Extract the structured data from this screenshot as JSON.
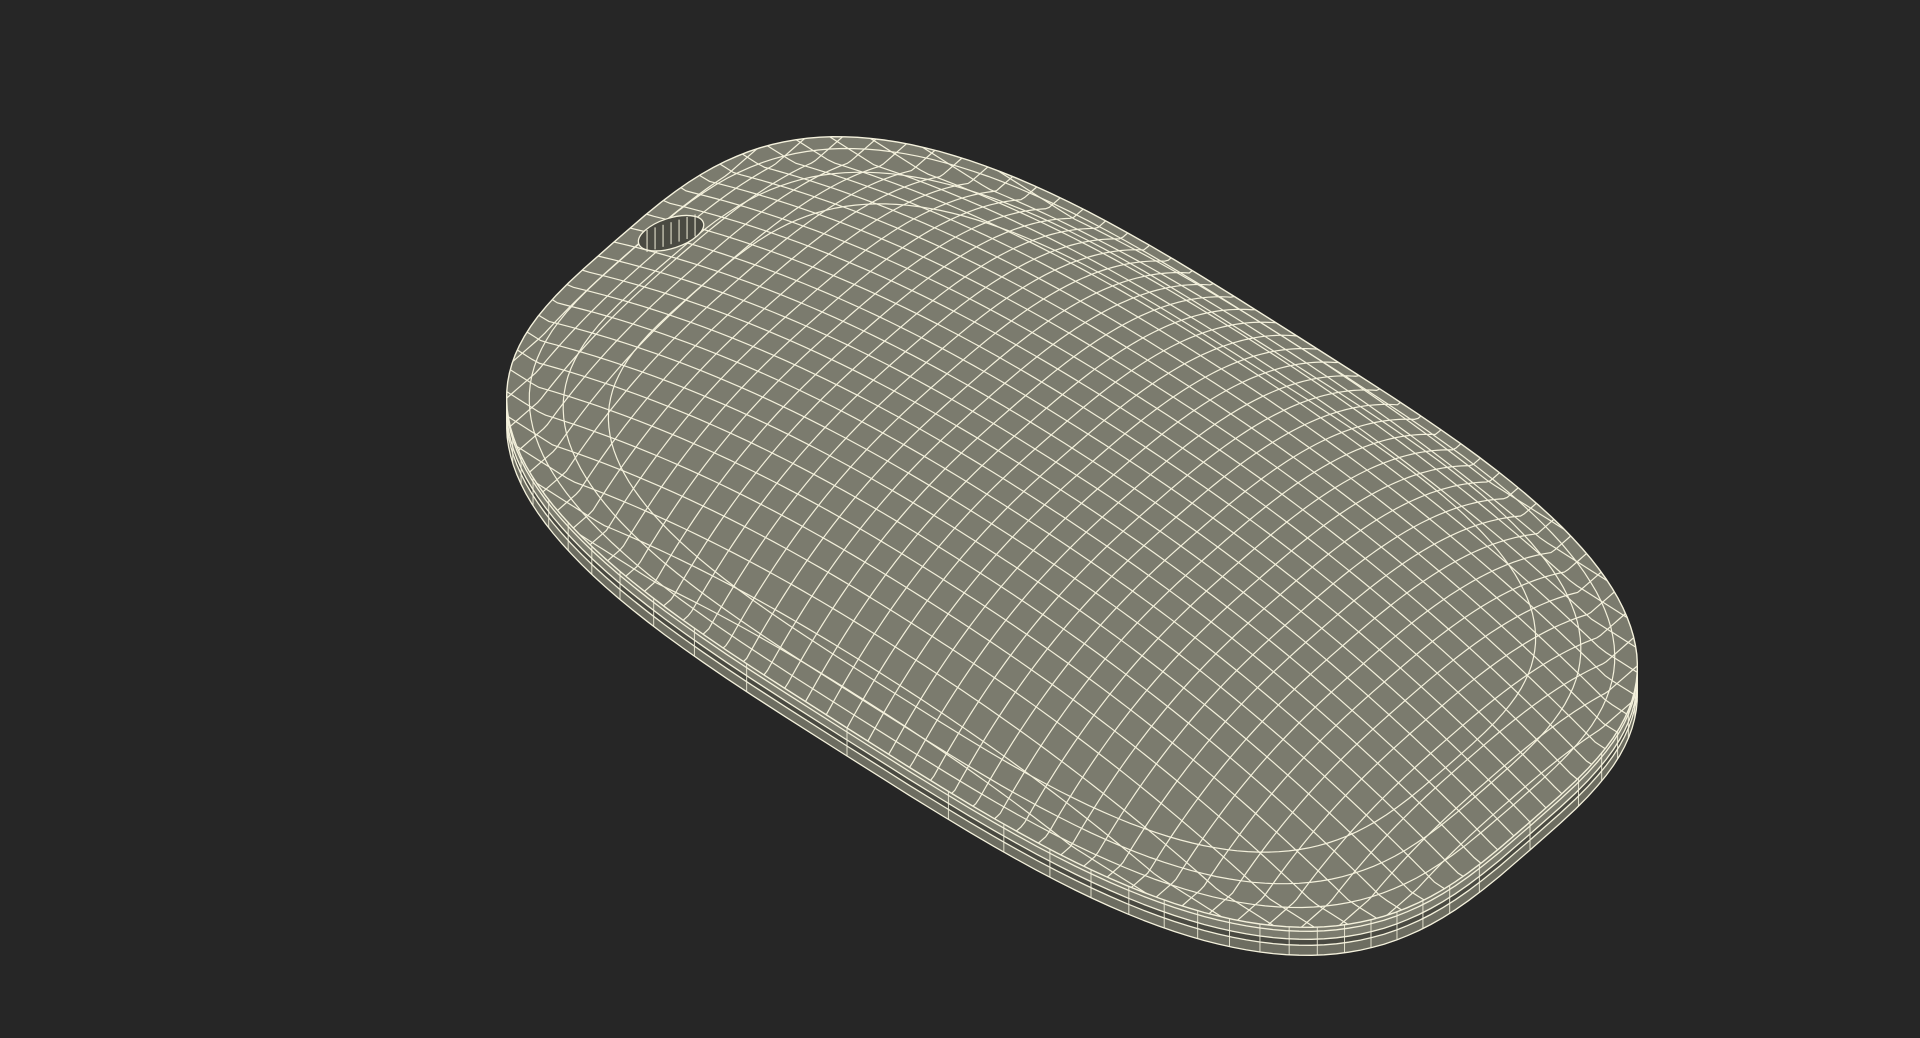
{
  "colors": {
    "background": "#262626",
    "surface": "#7b7b6e",
    "surface_shade": "#6d6d61",
    "seam": "#4a4a42",
    "wire": "#f4f1dc"
  },
  "render": {
    "subject": "computer-mouse",
    "style": "wireframe-shaded"
  }
}
